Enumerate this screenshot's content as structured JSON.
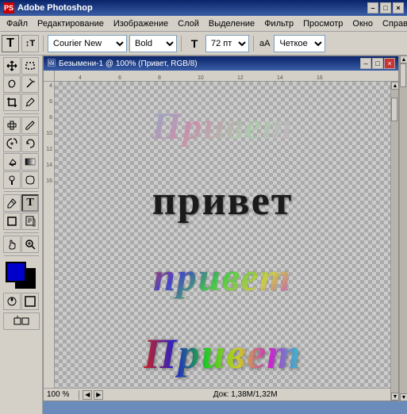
{
  "app": {
    "title": "Adobe Photoshop",
    "icon": "PS"
  },
  "titlebar": {
    "title": "Adobe Photoshop",
    "minimize": "–",
    "maximize": "□",
    "close": "×"
  },
  "menubar": {
    "items": [
      "Файл",
      "Редактирование",
      "Изображение",
      "Слой",
      "Выделение",
      "Фильтр",
      "Просмотр",
      "Окно",
      "Справк..."
    ]
  },
  "toolbar": {
    "text_tool": "T",
    "orientation": "↕T",
    "font_family": "Courier New",
    "font_style": "Bold",
    "font_size_icon": "T",
    "font_size": "72 пт",
    "aa_label": "аА",
    "antialiasing": "Четкое",
    "font_family_placeholder": "Courier New",
    "font_style_placeholder": "Bold",
    "font_size_placeholder": "72 пт",
    "antialiasing_placeholder": "Четкое"
  },
  "document": {
    "title": "Безымени-1 @ 100% (Привет, RGB/8)",
    "zoom": "100 %",
    "doc_size": "Док: 1,38M/1,32M",
    "minimize": "–",
    "maximize": "□",
    "close": "×"
  },
  "canvas": {
    "text_lines": [
      "Привет",
      "привет",
      "привет",
      "Привет"
    ]
  },
  "ruler": {
    "top_marks": [
      "4",
      "6",
      "8",
      "10",
      "12",
      "14",
      "16"
    ],
    "left_marks": [
      "4",
      "6",
      "8",
      "10",
      "12",
      "14",
      "16"
    ]
  },
  "tools": {
    "items": [
      {
        "name": "move",
        "icon": "✥"
      },
      {
        "name": "marquee",
        "icon": "▭"
      },
      {
        "name": "lasso",
        "icon": "⌒"
      },
      {
        "name": "magic-wand",
        "icon": "✦"
      },
      {
        "name": "crop",
        "icon": "⊡"
      },
      {
        "name": "eyedropper",
        "icon": "✏"
      },
      {
        "name": "heal",
        "icon": "✚"
      },
      {
        "name": "brush",
        "icon": "⌒"
      },
      {
        "name": "clone",
        "icon": "⊕"
      },
      {
        "name": "history",
        "icon": "⊗"
      },
      {
        "name": "eraser",
        "icon": "◻"
      },
      {
        "name": "gradient",
        "icon": "▨"
      },
      {
        "name": "dodge",
        "icon": "○"
      },
      {
        "name": "pen",
        "icon": "✒"
      },
      {
        "name": "text",
        "icon": "T"
      },
      {
        "name": "shape",
        "icon": "□"
      },
      {
        "name": "notes",
        "icon": "✉"
      },
      {
        "name": "hand",
        "icon": "✋"
      },
      {
        "name": "zoom",
        "icon": "⊕"
      }
    ]
  },
  "colors": {
    "foreground": "#0000cc",
    "background": "#000000",
    "accent": "#3b5ea6",
    "canvas_bg_light": "#cccccc",
    "canvas_bg_dark": "#aaaaaa",
    "toolbar_bg": "#d4d0c8"
  }
}
